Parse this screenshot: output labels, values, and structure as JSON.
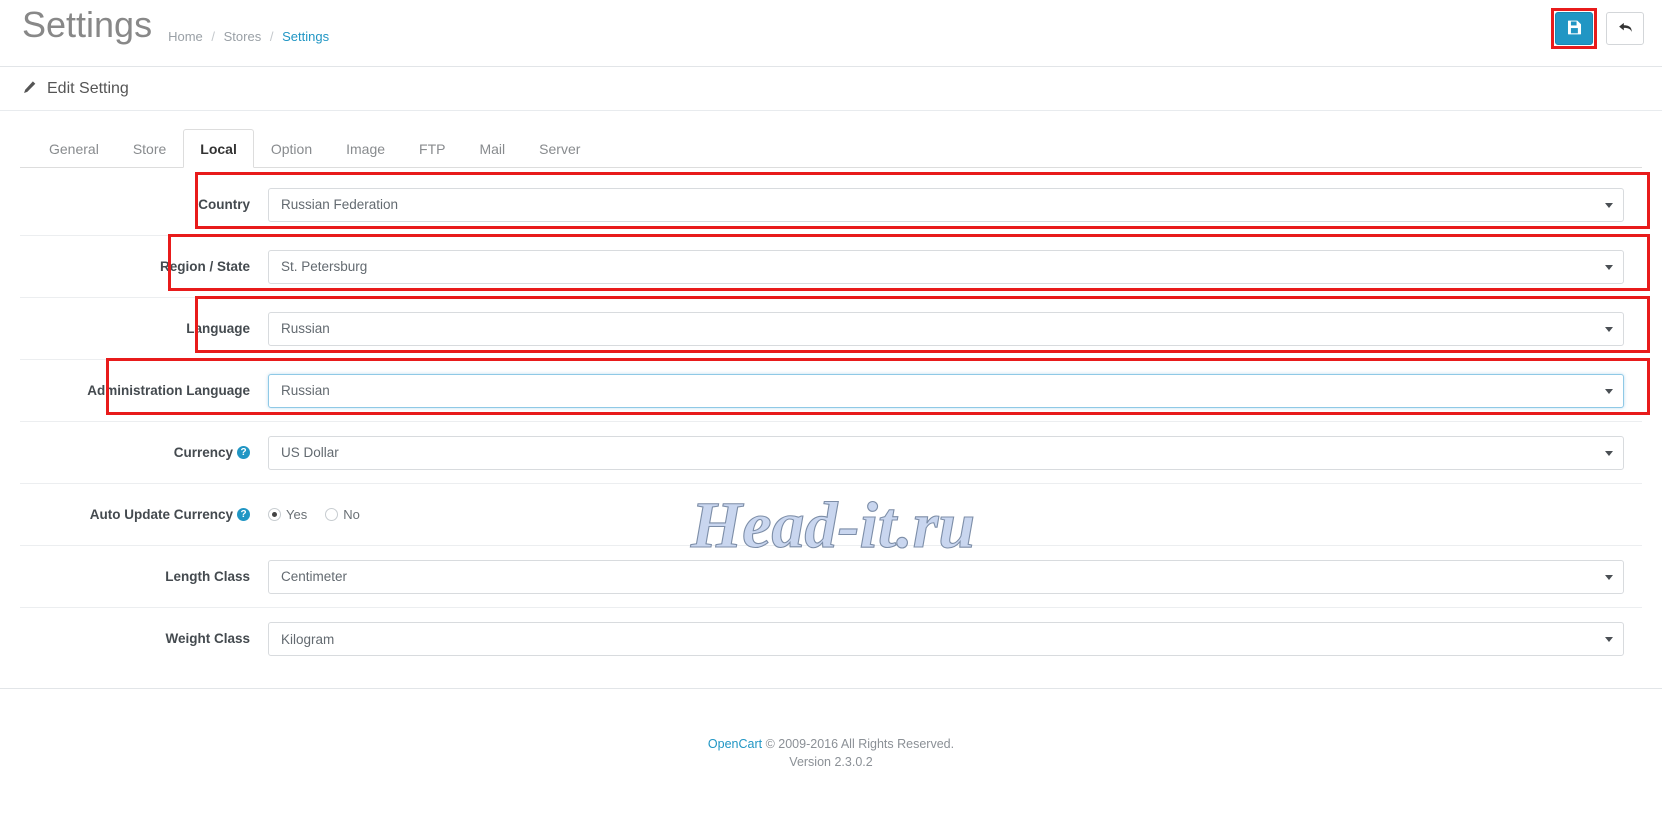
{
  "header": {
    "title": "Settings",
    "breadcrumb": [
      {
        "label": "Home",
        "current": false
      },
      {
        "label": "Stores",
        "current": false
      },
      {
        "label": "Settings",
        "current": true
      }
    ],
    "separator": "/",
    "save_button": {
      "icon": "floppy-disk-icon",
      "title": "Save"
    },
    "back_button": {
      "icon": "reply-arrow-icon",
      "title": "Back"
    },
    "accent_color": "#2196c4",
    "annotation_color": "#e81b1b"
  },
  "panel": {
    "heading": "Edit Setting",
    "heading_icon": "pencil-icon"
  },
  "tabs": [
    {
      "label": "General",
      "active": false
    },
    {
      "label": "Store",
      "active": false
    },
    {
      "label": "Local",
      "active": true
    },
    {
      "label": "Option",
      "active": false
    },
    {
      "label": "Image",
      "active": false
    },
    {
      "label": "FTP",
      "active": false
    },
    {
      "label": "Mail",
      "active": false
    },
    {
      "label": "Server",
      "active": false
    }
  ],
  "form": {
    "country": {
      "label": "Country",
      "value": "Russian Federation"
    },
    "region": {
      "label": "Region / State",
      "value": "St. Petersburg"
    },
    "language": {
      "label": "Language",
      "value": "Russian"
    },
    "admin_language": {
      "label": "Administration Language",
      "value": "Russian"
    },
    "currency": {
      "label": "Currency",
      "value": "US Dollar",
      "help": "?"
    },
    "auto_update_currency": {
      "label": "Auto Update Currency",
      "help": "?",
      "options": [
        {
          "label": "Yes",
          "checked": true
        },
        {
          "label": "No",
          "checked": false
        }
      ]
    },
    "length_class": {
      "label": "Length Class",
      "value": "Centimeter"
    },
    "weight_class": {
      "label": "Weight Class",
      "value": "Kilogram"
    }
  },
  "watermark": {
    "text": "Head-it.ru"
  },
  "footer": {
    "brand": "OpenCart",
    "copyright": "© 2009-2016 All Rights Reserved.",
    "version": "Version 2.3.0.2"
  }
}
